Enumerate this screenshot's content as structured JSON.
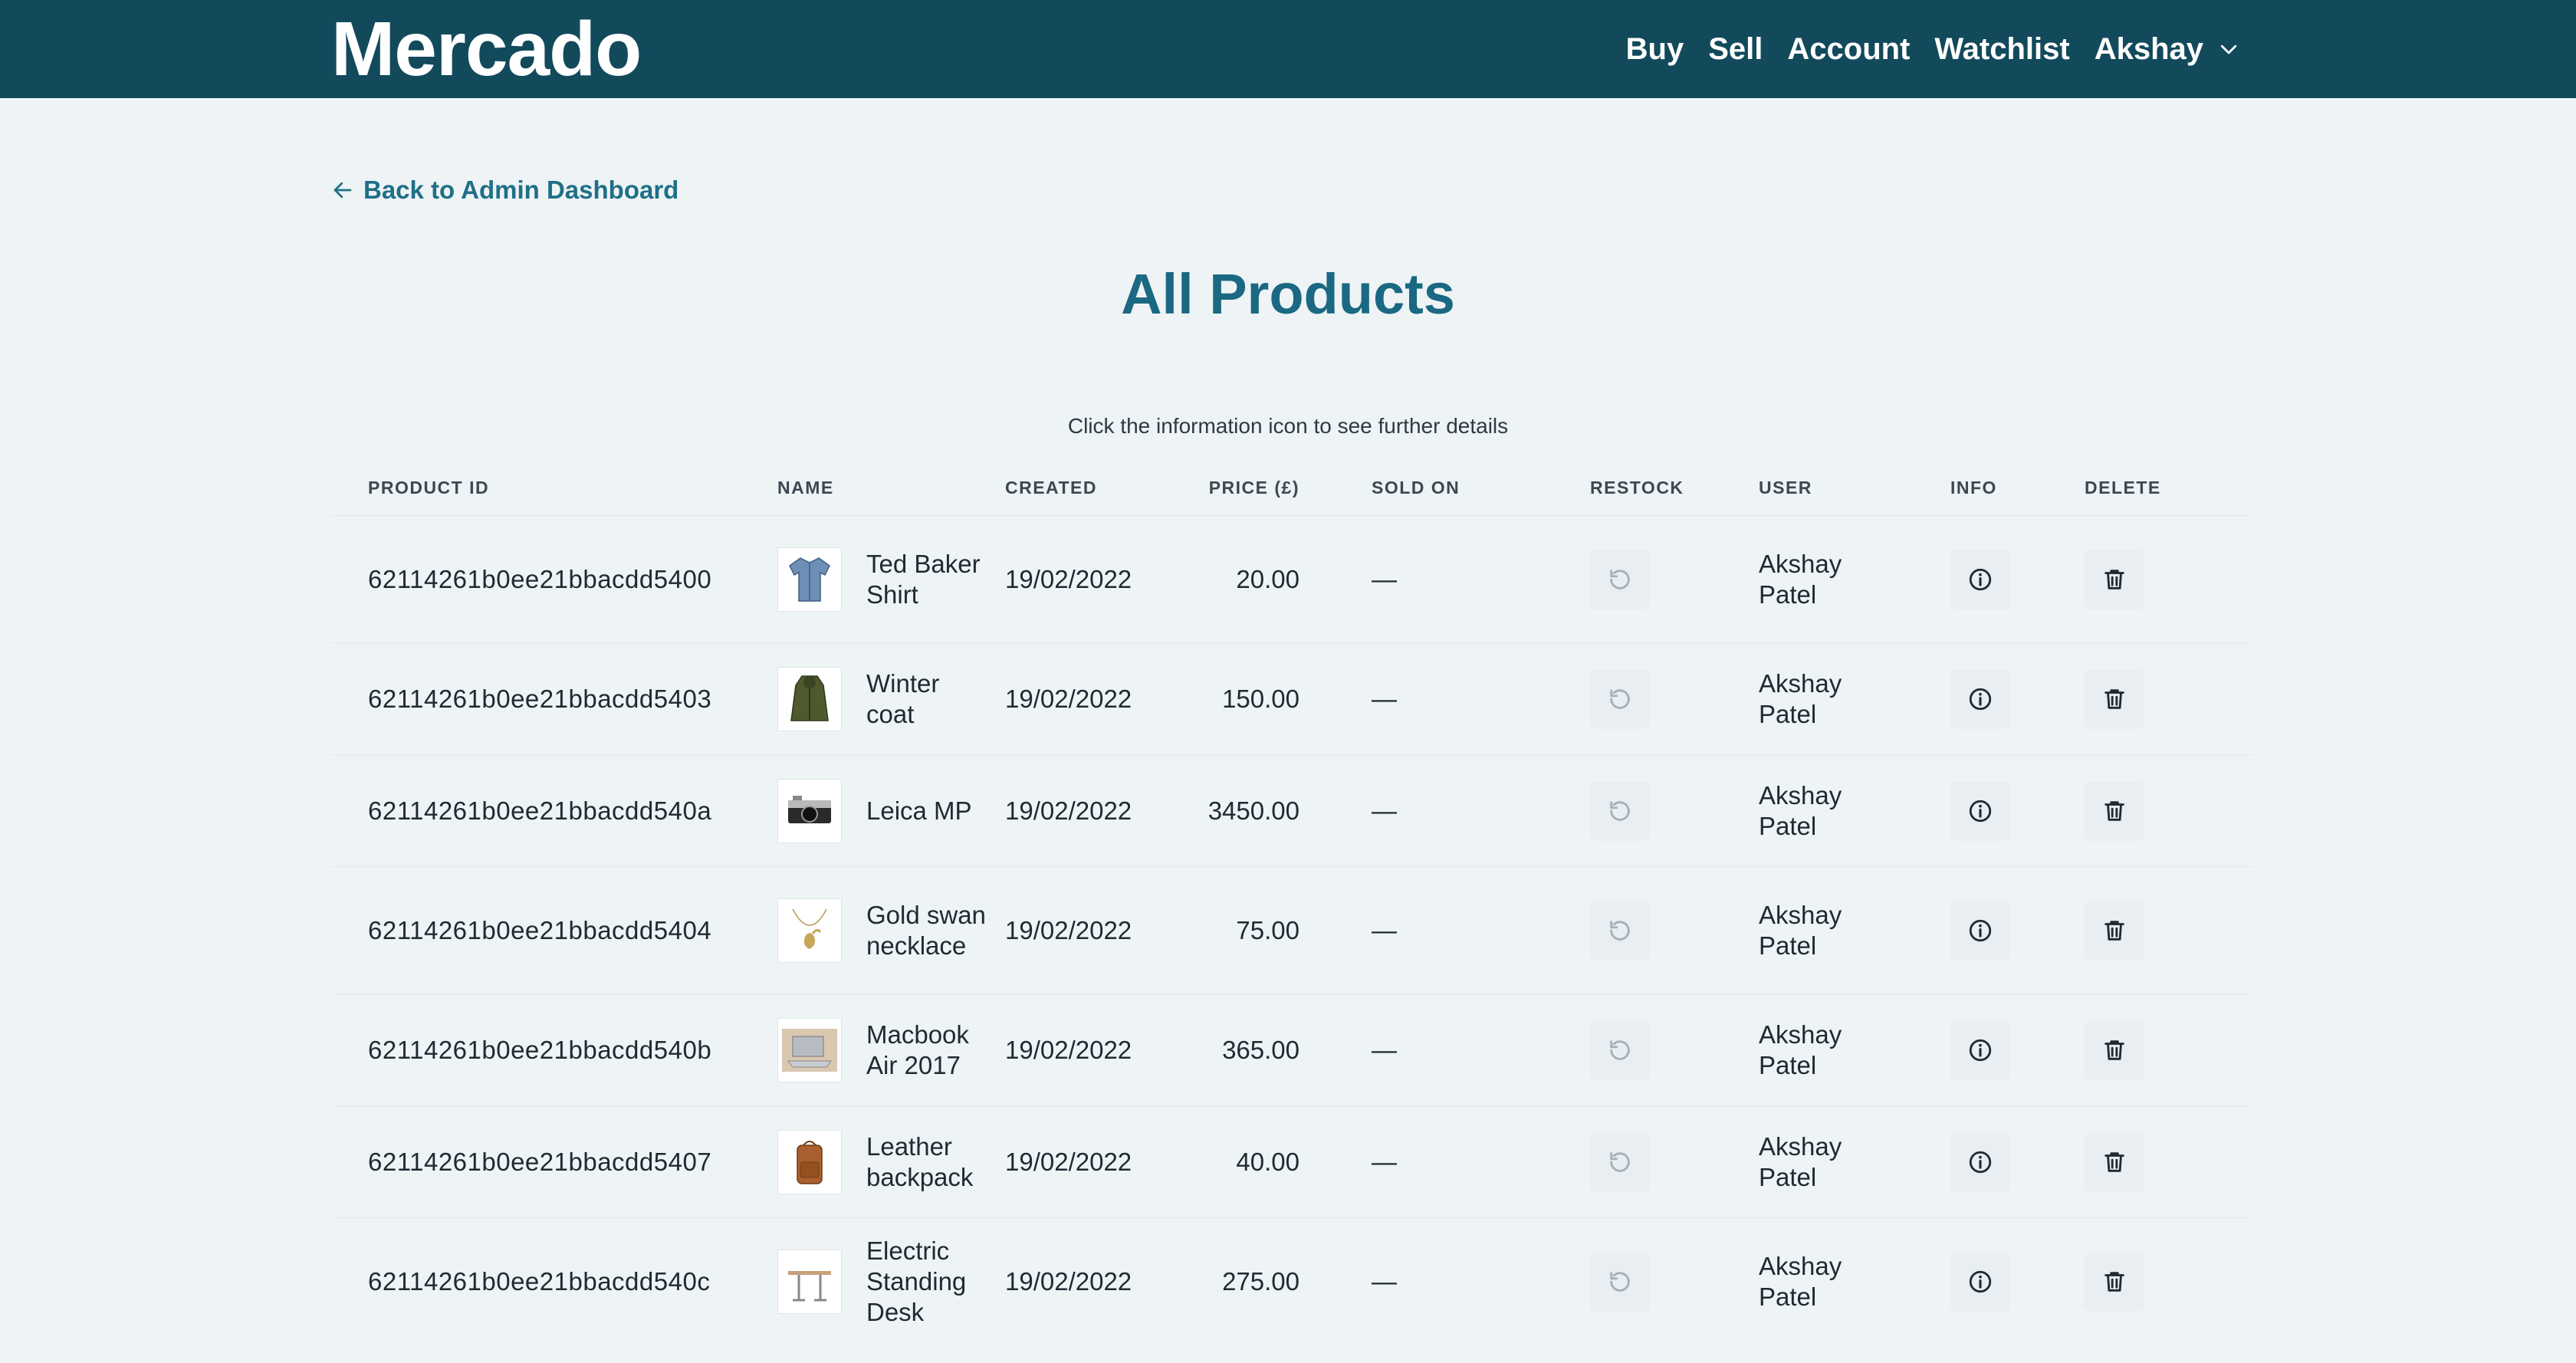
{
  "nav": {
    "brand": "Mercado",
    "links": [
      "Buy",
      "Sell",
      "Account",
      "Watchlist"
    ],
    "user": "Akshay"
  },
  "back_link": "Back to Admin Dashboard",
  "page_title": "All Products",
  "hint": "Click the information icon to see further details",
  "table": {
    "headers": [
      "PRODUCT ID",
      "NAME",
      "CREATED",
      "PRICE (£)",
      "SOLD ON",
      "RESTOCK",
      "USER",
      "INFO",
      "DELETE"
    ],
    "rows": [
      {
        "id": "62114261b0ee21bbacdd5400",
        "name": "Ted Baker Shirt",
        "created": "19/02/2022",
        "price": "20.00",
        "sold_on": "—",
        "user": "Akshay Patel",
        "thumb": "shirt"
      },
      {
        "id": "62114261b0ee21bbacdd5403",
        "name": "Winter coat",
        "created": "19/02/2022",
        "price": "150.00",
        "sold_on": "—",
        "user": "Akshay Patel",
        "thumb": "coat"
      },
      {
        "id": "62114261b0ee21bbacdd540a",
        "name": "Leica MP",
        "created": "19/02/2022",
        "price": "3450.00",
        "sold_on": "—",
        "user": "Akshay Patel",
        "thumb": "camera"
      },
      {
        "id": "62114261b0ee21bbacdd5404",
        "name": "Gold swan necklace",
        "created": "19/02/2022",
        "price": "75.00",
        "sold_on": "—",
        "user": "Akshay Patel",
        "thumb": "necklace"
      },
      {
        "id": "62114261b0ee21bbacdd540b",
        "name": "Macbook Air 2017",
        "created": "19/02/2022",
        "price": "365.00",
        "sold_on": "—",
        "user": "Akshay Patel",
        "thumb": "laptop"
      },
      {
        "id": "62114261b0ee21bbacdd5407",
        "name": "Leather backpack",
        "created": "19/02/2022",
        "price": "40.00",
        "sold_on": "—",
        "user": "Akshay Patel",
        "thumb": "backpack"
      },
      {
        "id": "62114261b0ee21bbacdd540c",
        "name": "Electric Standing Desk",
        "created": "19/02/2022",
        "price": "275.00",
        "sold_on": "—",
        "user": "Akshay Patel",
        "thumb": "desk"
      }
    ]
  },
  "colors": {
    "navbar": "#124a5c",
    "accent": "#1a6882",
    "link": "#1f6f87",
    "background": "#eef3f5"
  },
  "icons": {
    "back": "arrow-left-icon",
    "user_menu": "chevron-down-icon",
    "restock": "restock-icon",
    "info": "info-icon",
    "delete": "trash-icon"
  }
}
